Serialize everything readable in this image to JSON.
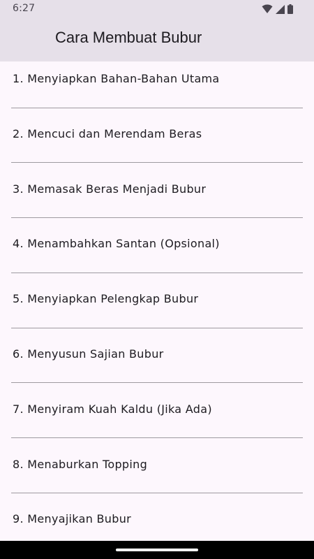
{
  "status_bar": {
    "time": "6:27",
    "icons": [
      "wifi-icon",
      "signal-icon",
      "battery-icon"
    ]
  },
  "app_bar": {
    "title": "Cara Membuat Bubur"
  },
  "steps": [
    {
      "label": "1. Menyiapkan Bahan-Bahan Utama"
    },
    {
      "label": "2. Mencuci dan Merendam Beras"
    },
    {
      "label": "3. Memasak Beras Menjadi Bubur"
    },
    {
      "label": "4. Menambahkan Santan (Opsional)"
    },
    {
      "label": "5. Menyiapkan Pelengkap Bubur"
    },
    {
      "label": "6. Menyusun Sajian Bubur"
    },
    {
      "label": "7. Menyiram Kuah Kaldu (Jika Ada)"
    },
    {
      "label": "8. Menaburkan Topping"
    },
    {
      "label": "9. Menyajikan Bubur"
    }
  ],
  "colors": {
    "app_bar_background": "#e6e0e9",
    "page_background": "#fdf7fd",
    "divider": "#9e9aa0",
    "text": "#1d1b20"
  }
}
